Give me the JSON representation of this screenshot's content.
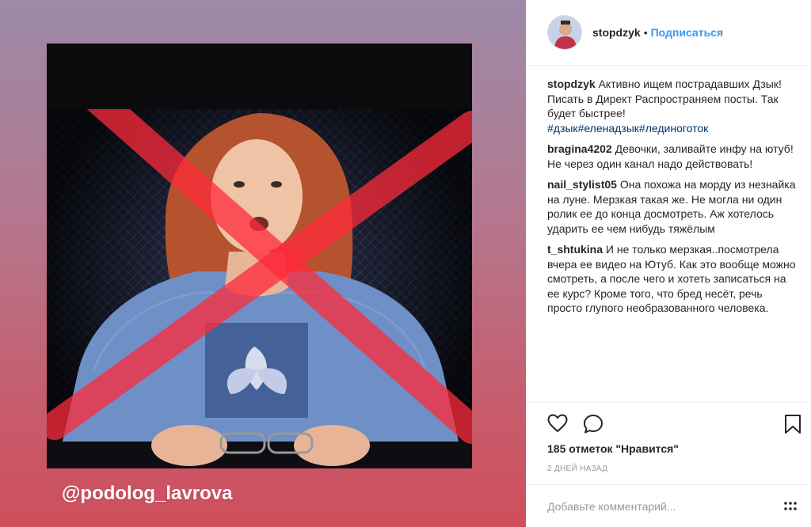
{
  "media": {
    "watermark": "@podolog_lavrova",
    "cross_color": "#ff2a3a",
    "image_description": "woman-behind-crossed-out"
  },
  "header": {
    "username": "stopdzyk",
    "separator": "•",
    "follow_label": "Подписаться",
    "follow_color": "#3897f0"
  },
  "caption": {
    "username": "stopdzyk",
    "text": "Активно ищем пострадавших Дзык! Писать в Директ Распространяем посты. Так будет быстрее!",
    "hashtags": [
      "#дзык",
      "#еленадзык",
      "#лединоготок"
    ]
  },
  "comments": [
    {
      "username": "bragina4202",
      "text": "Девочки, заливайте инфу на ютуб! Не через один канал надо действовать!"
    },
    {
      "username": "nail_stylist05",
      "text": "Она похожа на морду из незнайка на луне. Мерзкая такая же. Не могла ни один ролик ее до конца досмотреть. Аж хотелось ударить ее чем нибудь тяжёлым"
    },
    {
      "username": "t_shtukina",
      "text": "И не только мерзкая..посмотрела вчера ее видео на Ютуб. Как это вообще можно смотреть, а после чего и хотеть записаться на ее курс? Кроме того, что бред несёт, речь просто глупого необразованного человека."
    }
  ],
  "actions": {
    "like_icon": "heart-icon",
    "comment_icon": "comment-bubble-icon",
    "save_icon": "bookmark-icon"
  },
  "likes_text": "185 отметок \"Нравится\"",
  "date_text": "2 ДНЕЙ НАЗАД",
  "add_comment": {
    "placeholder": "Добавьте комментарий...",
    "more_icon": "more-dots-icon"
  }
}
